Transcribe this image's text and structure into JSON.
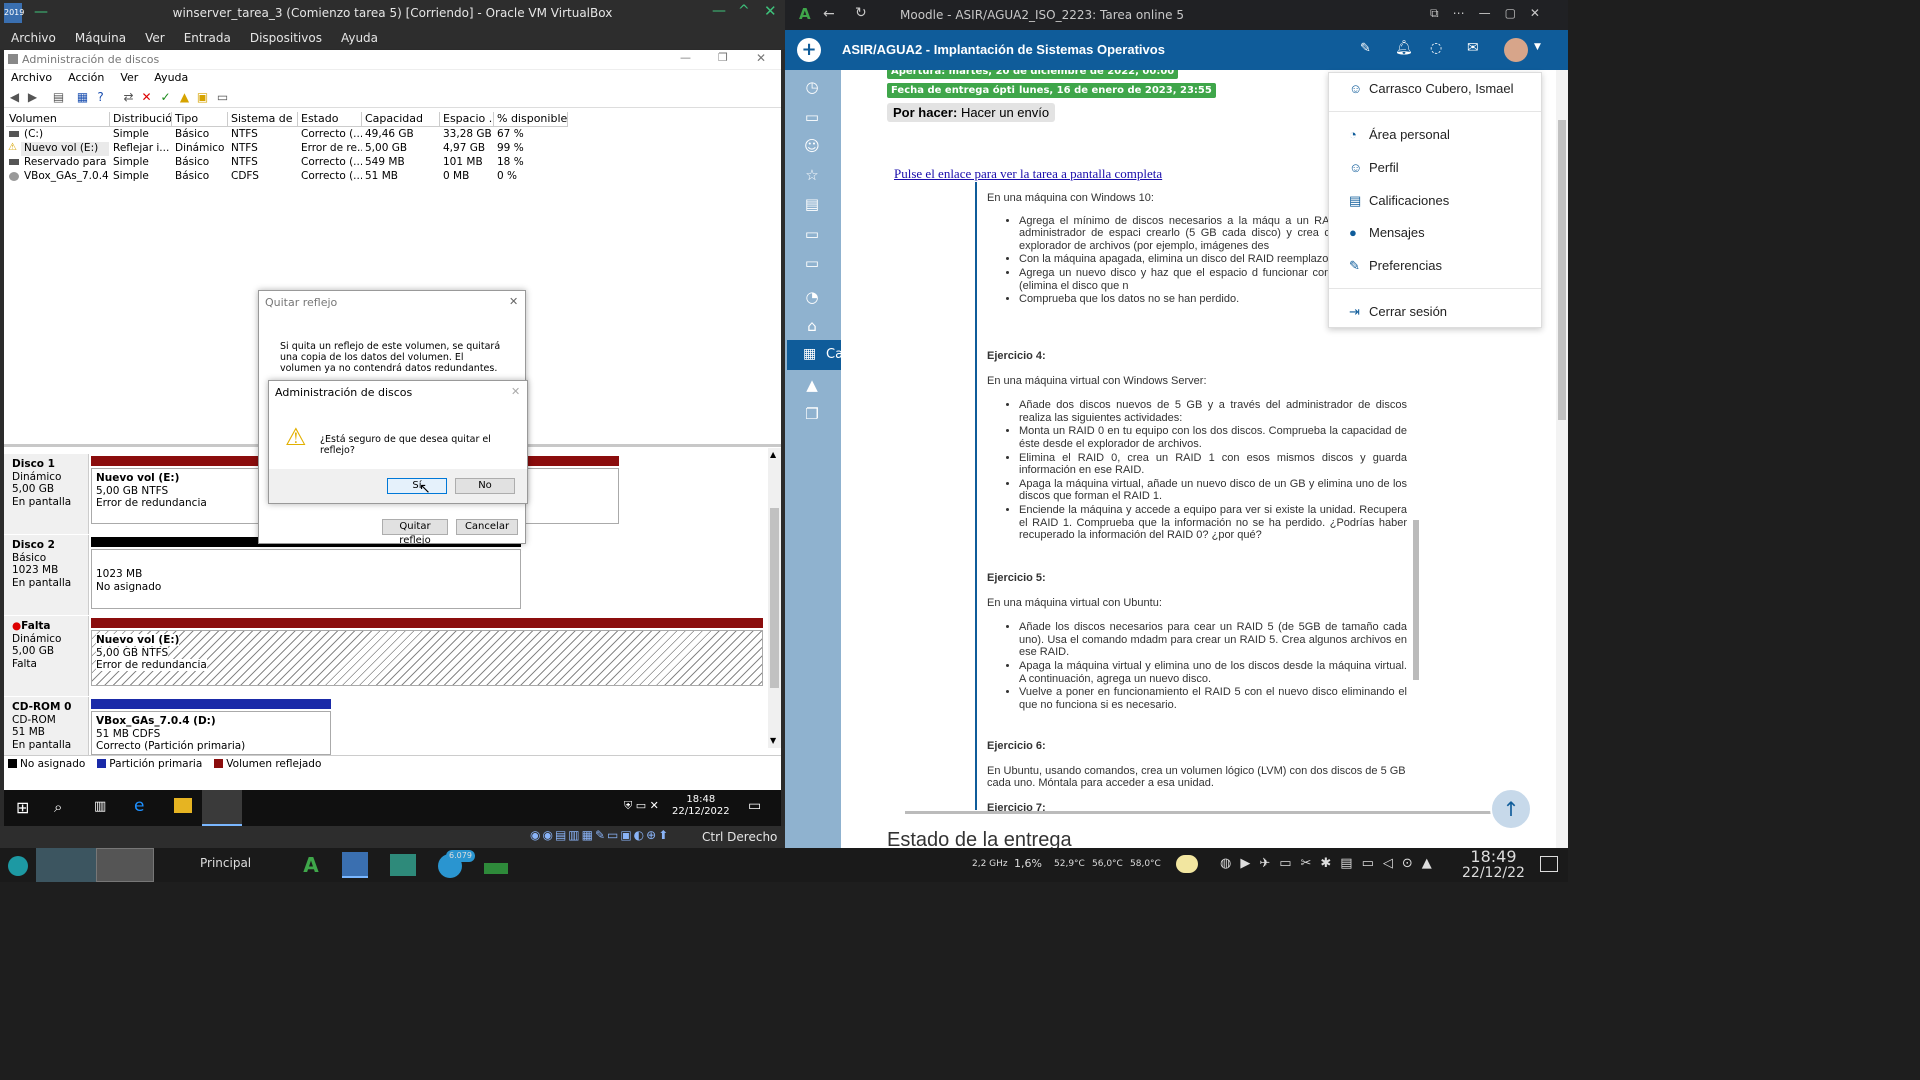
{
  "vbox": {
    "title": "winserver_tarea_3 (Comienzo tarea 5) [Corriendo] - Oracle VM VirtualBox",
    "menu": [
      "Archivo",
      "Máquina",
      "Ver",
      "Entrada",
      "Dispositivos",
      "Ayuda"
    ],
    "status_right": "Ctrl Derecho"
  },
  "dm": {
    "title": "Administración de discos",
    "menu": [
      "Archivo",
      "Acción",
      "Ver",
      "Ayuda"
    ],
    "columns": [
      "Volumen",
      "Distribución",
      "Tipo",
      "Sistema de ...",
      "Estado",
      "Capacidad",
      "Espacio ...",
      "% disponible"
    ],
    "rows": [
      [
        "(C:)",
        "Simple",
        "Básico",
        "NTFS",
        "Correcto (...",
        "49,46 GB",
        "33,28 GB",
        "67 %"
      ],
      [
        "Nuevo vol (E:)",
        "Reflejar i...",
        "Dinámico",
        "NTFS",
        "Error de re...",
        "5,00 GB",
        "4,97 GB",
        "99 %"
      ],
      [
        "Reservado para el ...",
        "Simple",
        "Básico",
        "NTFS",
        "Correcto (...",
        "549 MB",
        "101 MB",
        "18 %"
      ],
      [
        "VBox_GAs_7.0.4 (D:)",
        "Simple",
        "Básico",
        "CDFS",
        "Correcto (...",
        "51 MB",
        "0 MB",
        "0 %"
      ]
    ],
    "disks": [
      {
        "name": "Disco 1",
        "type": "Dinámico",
        "size": "5,00 GB",
        "state": "En pantalla",
        "part_name": "Nuevo vol  (E:)",
        "part_size": "5,00 GB NTFS",
        "part_state": "Error de redundancia"
      },
      {
        "name": "Disco 2",
        "type": "Básico",
        "size": "1023 MB",
        "state": "En pantalla",
        "part_name": "",
        "part_size": "1023 MB",
        "part_state": "No asignado"
      },
      {
        "name": "Falta",
        "type": "Dinámico",
        "size": "5,00 GB",
        "state": "Falta",
        "part_name": "Nuevo vol  (E:)",
        "part_size": "5,00 GB NTFS",
        "part_state": "Error de redundancia"
      },
      {
        "name": "CD-ROM 0",
        "type": "CD-ROM",
        "size": "51 MB",
        "state": "En pantalla",
        "part_name": "VBox_GAs_7.0.4  (D:)",
        "part_size": "51 MB CDFS",
        "part_state": "Correcto (Partición primaria)"
      }
    ],
    "legend": [
      "No asignado",
      "Partición primaria",
      "Volumen reflejado"
    ],
    "legend_colors": [
      "#000000",
      "#1a2aa8",
      "#8b0d0d"
    ]
  },
  "dialog_back": {
    "title": "Quitar reflejo",
    "text": "Si quita un reflejo de este volumen, se quitará una copia de los datos del volumen. El volumen ya no contendrá datos redundantes.",
    "ok": "Quitar reflejo",
    "cancel": "Cancelar"
  },
  "dialog_front": {
    "title": "Administración de discos",
    "text": "¿Está seguro de que desea quitar el reflejo?",
    "yes": "Sí",
    "no": "No"
  },
  "win_taskbar": {
    "time": "18:48",
    "date": "22/12/2022"
  },
  "browser": {
    "tab_title": "Moodle - ASIR/AGUA2_ISO_2223: Tarea online 5",
    "course": "ASIR/AGUA2 - Implantación de Sistemas Operativos",
    "opening": "Apertura: martes, 20 de diciembre de 2022, 00:00",
    "due_label": "Fecha de entrega óptima:",
    "due_value": "lunes, 16 de enero de 2023, 23:55",
    "todo_label": "Por hacer:",
    "todo_value": "Hacer un envío",
    "link": "Pulse el enlace para ver la tarea a pantalla completa",
    "calendar": "Calendario",
    "status_heading": "Estado de la entrega"
  },
  "task": {
    "intro": "En una máquina con Windows 10:",
    "intro_items": [
      "Agrega el mínimo de discos necesarios a la máqu a un RAID 1 usando el administrador de espaci crearlo (5 GB cada disco) y crea contenido en es explorador de archivos (por ejemplo, imágenes des",
      "Con la máquina apagada, elimina un disco del RAID reemplazo de disco).",
      "Agrega un nuevo disco y haz que el espacio d funcionar con los dos discos (elimina el disco que n",
      "Comprueba que los datos no se han perdido."
    ],
    "ex4_title": "Ejercicio 4:",
    "ex4_intro": "En una máquina virtual con Windows Server:",
    "ex4_items": [
      "Añade dos discos nuevos de 5 GB y a través del administrador de discos realiza las siguientes actividades:",
      "Monta un RAID 0 en tu equipo con los dos discos. Comprueba la capacidad de éste desde el explorador de archivos.",
      "Elimina el RAID 0, crea un RAID 1 con esos mismos discos y guarda información en ese RAID.",
      "Apaga la máquina virtual, añade un nuevo disco de un GB y elimina uno de los discos que forman el RAID 1.",
      "Enciende la máquina y accede a equipo para ver si existe la unidad. Recupera el RAID 1. Comprueba que la información no se ha perdido. ¿Podrías haber recuperado la información del RAID 0? ¿por qué?"
    ],
    "ex5_title": "Ejercicio 5:",
    "ex5_intro": "En una máquina virtual con Ubuntu:",
    "ex5_items": [
      "Añade los discos necesarios para cear un RAID 5 (de 5GB de tamaño cada uno). Usa el comando mdadm para crear un RAID 5.  Crea algunos archivos en ese RAID.",
      "Apaga la máquina virtual y elimina uno de los discos desde la máquina virtual. A continuación, agrega un nuevo disco.",
      "Vuelve a poner en funcionamiento el RAID 5 con el nuevo disco eliminando el que no funciona si es necesario."
    ],
    "ex6_title": "Ejercicio 6:",
    "ex6_text": "En Ubuntu, usando comandos, crea un volumen lógico (LVM) con dos discos de 5 GB cada uno.  Móntala para acceder a esa unidad.",
    "ex7_title": "Ejercicio 7:"
  },
  "user_menu": {
    "name": "Carrasco Cubero, Ismael",
    "items": [
      "Área personal",
      "Perfil",
      "Calificaciones",
      "Mensajes",
      "Preferencias"
    ],
    "logout": "Cerrar sesión"
  },
  "host_taskbar": {
    "workspace": "Principal",
    "badge": "6.079",
    "cpu_freq": "2,2 GHz",
    "cpu_load": "1,6%",
    "temps": [
      "52,9°C",
      "56,0°C",
      "58,0°C"
    ],
    "time": "18:49",
    "date": "22/12/22"
  },
  "colors": {
    "moodle_blue": "#0f5c9a",
    "green_badge": "#3fa64a",
    "mirror_red": "#8b0d0d"
  }
}
